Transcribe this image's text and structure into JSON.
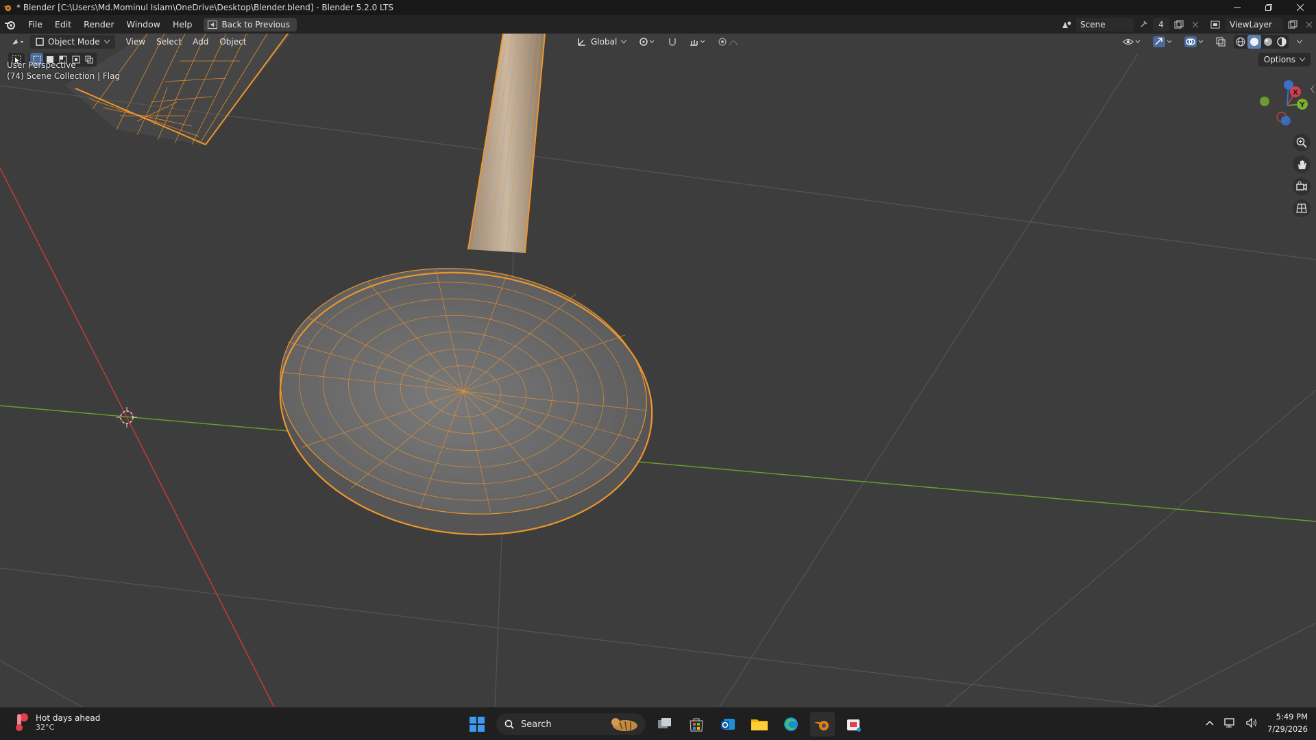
{
  "window": {
    "title": "* Blender [C:\\Users\\Md.Mominul Islam\\OneDrive\\Desktop\\Blender.blend] - Blender 5.2.0 LTS"
  },
  "menubar": {
    "items": [
      "File",
      "Edit",
      "Render",
      "Window",
      "Help"
    ],
    "back_button": "Back to Previous",
    "scene_name": "Scene",
    "scene_users": "4",
    "view_layer": "ViewLayer"
  },
  "viewport_header": {
    "mode": "Object Mode",
    "menus": [
      "View",
      "Select",
      "Add",
      "Object"
    ],
    "transform_orientation": "Global"
  },
  "viewport": {
    "perspective": "User Perspective",
    "collection_info": "(74) Scene Collection | Flag",
    "options_label": "Options",
    "gizmo_axes": {
      "x": "X",
      "y": "Y"
    },
    "colors": {
      "background": "#3d3d3d",
      "selection": "#f0952a",
      "x_axis": "#c83a3a",
      "y_axis": "#6c9b2e",
      "grid": "#555555"
    }
  },
  "taskbar": {
    "weather_title": "Hot days ahead",
    "weather_temp": "32°C",
    "search_placeholder": "Search",
    "time": "5:49 PM",
    "date": "7/29/2026"
  }
}
